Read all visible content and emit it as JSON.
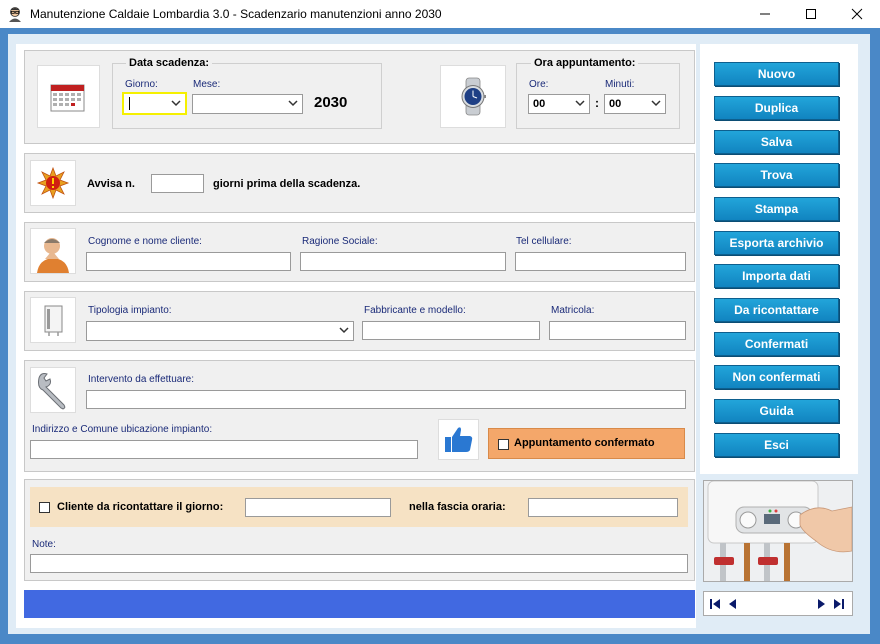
{
  "window": {
    "title": "Manutenzione Caldaie Lombardia 3.0 - Scadenzario manutenzioni anno 2030",
    "app_icon": "user-glasses-icon",
    "minimize_icon": "minimize-icon",
    "maximize_icon": "maximize-icon",
    "close_icon": "close-icon"
  },
  "due_date": {
    "legend": "Data scadenza:",
    "day_label": "Giorno:",
    "month_label": "Mese:",
    "day_value": "",
    "month_value": "",
    "year": "2030",
    "icon": "calendar-icon"
  },
  "appointment_time": {
    "legend": "Ora appuntamento:",
    "hours_label": "Ore:",
    "minutes_label": "Minuti:",
    "hours_value": "00",
    "minutes_value": "00",
    "separator": ":",
    "icon": "wristwatch-icon"
  },
  "reminder": {
    "prefix": "Avvisa n.",
    "suffix": "giorni prima della scadenza.",
    "value": "",
    "icon": "alarm-icon"
  },
  "client": {
    "name_label": "Cognome e nome cliente:",
    "company_label": "Ragione Sociale:",
    "phone_label": "Tel cellulare:",
    "icon": "person-icon"
  },
  "system": {
    "type_label": "Tipologia impianto:",
    "maker_label": "Fabbricante e modello:",
    "serial_label": "Matricola:",
    "icon": "boiler-icon"
  },
  "intervention": {
    "label": "Intervento da effettuare:",
    "address_label": "Indirizzo e Comune ubicazione impianto:",
    "confirmed_label": "Appuntamento confermato",
    "confirmed_checked": false,
    "icon": "wrench-icon",
    "thumb_icon": "thumbs-up-icon"
  },
  "recontact": {
    "label": "Cliente da ricontattare il giorno:",
    "slot_label": "nella fascia oraria:",
    "checked": false,
    "notes_label": "Note:"
  },
  "buttons": [
    "Nuovo",
    "Duplica",
    "Salva",
    "Trova",
    "Stampa",
    "Esporta archivio",
    "Importa dati",
    "Da ricontattare",
    "Confermati",
    "Non confermati",
    "Guida",
    "Esci"
  ],
  "nav": {
    "first_icon": "first-record-icon",
    "prev_icon": "previous-record-icon",
    "next_icon": "next-record-icon",
    "last_icon": "last-record-icon"
  },
  "colors": {
    "frame": "#4a88c7",
    "button": "#1b96d1",
    "status_bar": "#4169e1",
    "confirm_box": "#f4a76a",
    "recontact_box": "#f6e2c4",
    "focus_border": "#f5f000"
  },
  "photo": {
    "icon": "boiler-control-photo-icon"
  }
}
